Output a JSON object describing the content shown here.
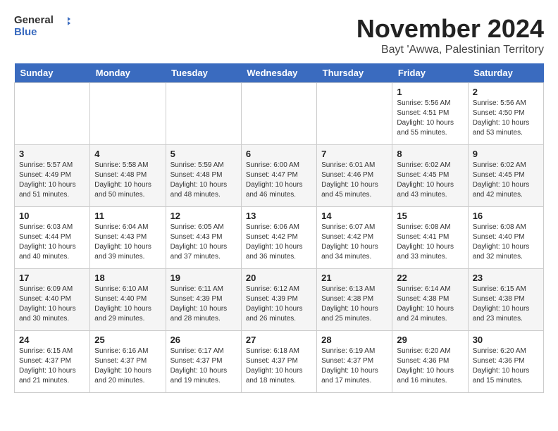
{
  "header": {
    "logo_general": "General",
    "logo_blue": "Blue",
    "month_title": "November 2024",
    "location": "Bayt 'Awwa, Palestinian Territory"
  },
  "weekdays": [
    "Sunday",
    "Monday",
    "Tuesday",
    "Wednesday",
    "Thursday",
    "Friday",
    "Saturday"
  ],
  "weeks": [
    [
      {
        "day": "",
        "info": ""
      },
      {
        "day": "",
        "info": ""
      },
      {
        "day": "",
        "info": ""
      },
      {
        "day": "",
        "info": ""
      },
      {
        "day": "",
        "info": ""
      },
      {
        "day": "1",
        "info": "Sunrise: 5:56 AM\nSunset: 4:51 PM\nDaylight: 10 hours\nand 55 minutes."
      },
      {
        "day": "2",
        "info": "Sunrise: 5:56 AM\nSunset: 4:50 PM\nDaylight: 10 hours\nand 53 minutes."
      }
    ],
    [
      {
        "day": "3",
        "info": "Sunrise: 5:57 AM\nSunset: 4:49 PM\nDaylight: 10 hours\nand 51 minutes."
      },
      {
        "day": "4",
        "info": "Sunrise: 5:58 AM\nSunset: 4:48 PM\nDaylight: 10 hours\nand 50 minutes."
      },
      {
        "day": "5",
        "info": "Sunrise: 5:59 AM\nSunset: 4:48 PM\nDaylight: 10 hours\nand 48 minutes."
      },
      {
        "day": "6",
        "info": "Sunrise: 6:00 AM\nSunset: 4:47 PM\nDaylight: 10 hours\nand 46 minutes."
      },
      {
        "day": "7",
        "info": "Sunrise: 6:01 AM\nSunset: 4:46 PM\nDaylight: 10 hours\nand 45 minutes."
      },
      {
        "day": "8",
        "info": "Sunrise: 6:02 AM\nSunset: 4:45 PM\nDaylight: 10 hours\nand 43 minutes."
      },
      {
        "day": "9",
        "info": "Sunrise: 6:02 AM\nSunset: 4:45 PM\nDaylight: 10 hours\nand 42 minutes."
      }
    ],
    [
      {
        "day": "10",
        "info": "Sunrise: 6:03 AM\nSunset: 4:44 PM\nDaylight: 10 hours\nand 40 minutes."
      },
      {
        "day": "11",
        "info": "Sunrise: 6:04 AM\nSunset: 4:43 PM\nDaylight: 10 hours\nand 39 minutes."
      },
      {
        "day": "12",
        "info": "Sunrise: 6:05 AM\nSunset: 4:43 PM\nDaylight: 10 hours\nand 37 minutes."
      },
      {
        "day": "13",
        "info": "Sunrise: 6:06 AM\nSunset: 4:42 PM\nDaylight: 10 hours\nand 36 minutes."
      },
      {
        "day": "14",
        "info": "Sunrise: 6:07 AM\nSunset: 4:42 PM\nDaylight: 10 hours\nand 34 minutes."
      },
      {
        "day": "15",
        "info": "Sunrise: 6:08 AM\nSunset: 4:41 PM\nDaylight: 10 hours\nand 33 minutes."
      },
      {
        "day": "16",
        "info": "Sunrise: 6:08 AM\nSunset: 4:40 PM\nDaylight: 10 hours\nand 32 minutes."
      }
    ],
    [
      {
        "day": "17",
        "info": "Sunrise: 6:09 AM\nSunset: 4:40 PM\nDaylight: 10 hours\nand 30 minutes."
      },
      {
        "day": "18",
        "info": "Sunrise: 6:10 AM\nSunset: 4:40 PM\nDaylight: 10 hours\nand 29 minutes."
      },
      {
        "day": "19",
        "info": "Sunrise: 6:11 AM\nSunset: 4:39 PM\nDaylight: 10 hours\nand 28 minutes."
      },
      {
        "day": "20",
        "info": "Sunrise: 6:12 AM\nSunset: 4:39 PM\nDaylight: 10 hours\nand 26 minutes."
      },
      {
        "day": "21",
        "info": "Sunrise: 6:13 AM\nSunset: 4:38 PM\nDaylight: 10 hours\nand 25 minutes."
      },
      {
        "day": "22",
        "info": "Sunrise: 6:14 AM\nSunset: 4:38 PM\nDaylight: 10 hours\nand 24 minutes."
      },
      {
        "day": "23",
        "info": "Sunrise: 6:15 AM\nSunset: 4:38 PM\nDaylight: 10 hours\nand 23 minutes."
      }
    ],
    [
      {
        "day": "24",
        "info": "Sunrise: 6:15 AM\nSunset: 4:37 PM\nDaylight: 10 hours\nand 21 minutes."
      },
      {
        "day": "25",
        "info": "Sunrise: 6:16 AM\nSunset: 4:37 PM\nDaylight: 10 hours\nand 20 minutes."
      },
      {
        "day": "26",
        "info": "Sunrise: 6:17 AM\nSunset: 4:37 PM\nDaylight: 10 hours\nand 19 minutes."
      },
      {
        "day": "27",
        "info": "Sunrise: 6:18 AM\nSunset: 4:37 PM\nDaylight: 10 hours\nand 18 minutes."
      },
      {
        "day": "28",
        "info": "Sunrise: 6:19 AM\nSunset: 4:37 PM\nDaylight: 10 hours\nand 17 minutes."
      },
      {
        "day": "29",
        "info": "Sunrise: 6:20 AM\nSunset: 4:36 PM\nDaylight: 10 hours\nand 16 minutes."
      },
      {
        "day": "30",
        "info": "Sunrise: 6:20 AM\nSunset: 4:36 PM\nDaylight: 10 hours\nand 15 minutes."
      }
    ]
  ]
}
